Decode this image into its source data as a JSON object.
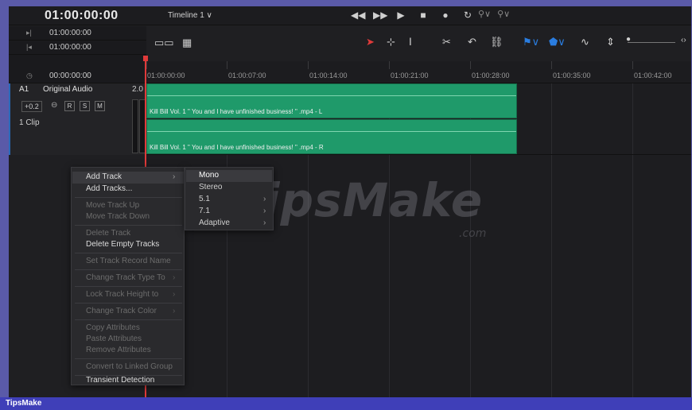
{
  "header": {
    "timecode": "01:00:00:00",
    "timeline_name": "Timeline 1 ∨"
  },
  "transport": {
    "rewind_icon": "rewind-icon",
    "forward_icon": "fast-forward-icon",
    "play_icon": "play-icon",
    "stop_icon": "stop-icon",
    "record_icon": "record-icon",
    "loop_icon": "loop-icon"
  },
  "left_header": {
    "rows": [
      {
        "icon": "in-point-icon",
        "glyph": "▸|",
        "tc": "01:00:00:00"
      },
      {
        "icon": "out-point-icon",
        "glyph": "|◂",
        "tc": "01:00:00:00"
      },
      {
        "icon": "clock-icon",
        "glyph": "◷",
        "tc": "00:00:00:00"
      }
    ]
  },
  "ruler": {
    "labels": [
      "01:00:00:00",
      "01:00:07:00",
      "01:00:14:00",
      "01:00:21:00",
      "01:00:28:00",
      "01:00:35:00",
      "01:00:42:00"
    ]
  },
  "track": {
    "id": "A1",
    "name": "Original Audio",
    "channels": "2.0",
    "volume": "+0.2",
    "buttons": [
      "R",
      "S",
      "M"
    ],
    "clip_count": "1 Clip"
  },
  "clips": [
    {
      "label": "Kill Bill Vol. 1  \" You and I have unfinished business! \" .mp4 - L"
    },
    {
      "label": "Kill Bill Vol. 1  \" You and I have unfinished business! \" .mp4 - R"
    }
  ],
  "context_menu": {
    "add_track": "Add Track",
    "add_tracks": "Add Tracks...",
    "move_up": "Move Track Up",
    "move_down": "Move Track Down",
    "delete_track": "Delete Track",
    "delete_empty": "Delete Empty Tracks",
    "set_record_name": "Set Track Record Name",
    "change_type": "Change Track Type To",
    "lock_height": "Lock Track Height to",
    "change_color": "Change Track Color",
    "copy_attr": "Copy Attributes",
    "paste_attr": "Paste Attributes",
    "remove_attr": "Remove Attributes",
    "convert_group": "Convert to Linked Group",
    "transient": "Transient Detection"
  },
  "submenu": {
    "mono": "Mono",
    "stereo": "Stereo",
    "s51": "5.1",
    "s71": "7.1",
    "adaptive": "Adaptive"
  },
  "watermark": {
    "main": "TipsMake",
    "suffix": ".com"
  },
  "footer": {
    "brand": "TipsMake"
  },
  "colors": {
    "clip": "#1f9a6a",
    "playhead": "#e03a3a",
    "frame_border": "#5a5aa8",
    "footer": "#3f3fb8"
  }
}
